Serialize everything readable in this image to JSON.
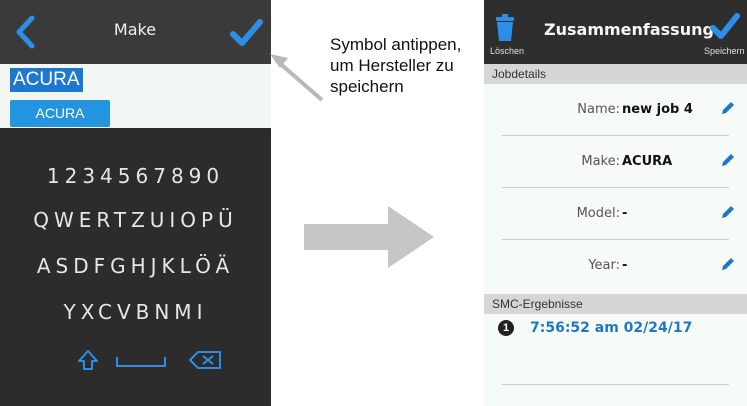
{
  "left_screen": {
    "title": "Make",
    "input_value": "ACURA",
    "suggestion": "ACURA",
    "keyboard_rows": [
      "1234567890",
      "QWERTZUIOPÜ",
      "ASDFGHJKLÖÄ",
      "YXCVBNMI"
    ],
    "icons": {
      "back": "back-arrow-icon",
      "confirm": "checkmark-icon",
      "shift": "shift-icon",
      "space": "space-icon",
      "backspace": "backspace-icon"
    }
  },
  "callout": {
    "text": "Symbol antippen, um Hersteller zu speichern"
  },
  "right_screen": {
    "title": "Zusammenfassung",
    "delete_label": "Löschen",
    "save_label": "Speichern",
    "section_jobdetails": "Jobdetails",
    "fields": [
      {
        "label": "Name:",
        "value": "new job 4"
      },
      {
        "label": "Make:",
        "value": "ACURA"
      },
      {
        "label": "Model:",
        "value": "-"
      },
      {
        "label": "Year:",
        "value": "-"
      }
    ],
    "section_smc": "SMC-Ergebnisse",
    "result_number": "1",
    "result_timestamp": "7:56:52 am 02/24/17"
  },
  "colors": {
    "accent_blue": "#1e78d2",
    "dark_bar": "#2e2e2e"
  }
}
